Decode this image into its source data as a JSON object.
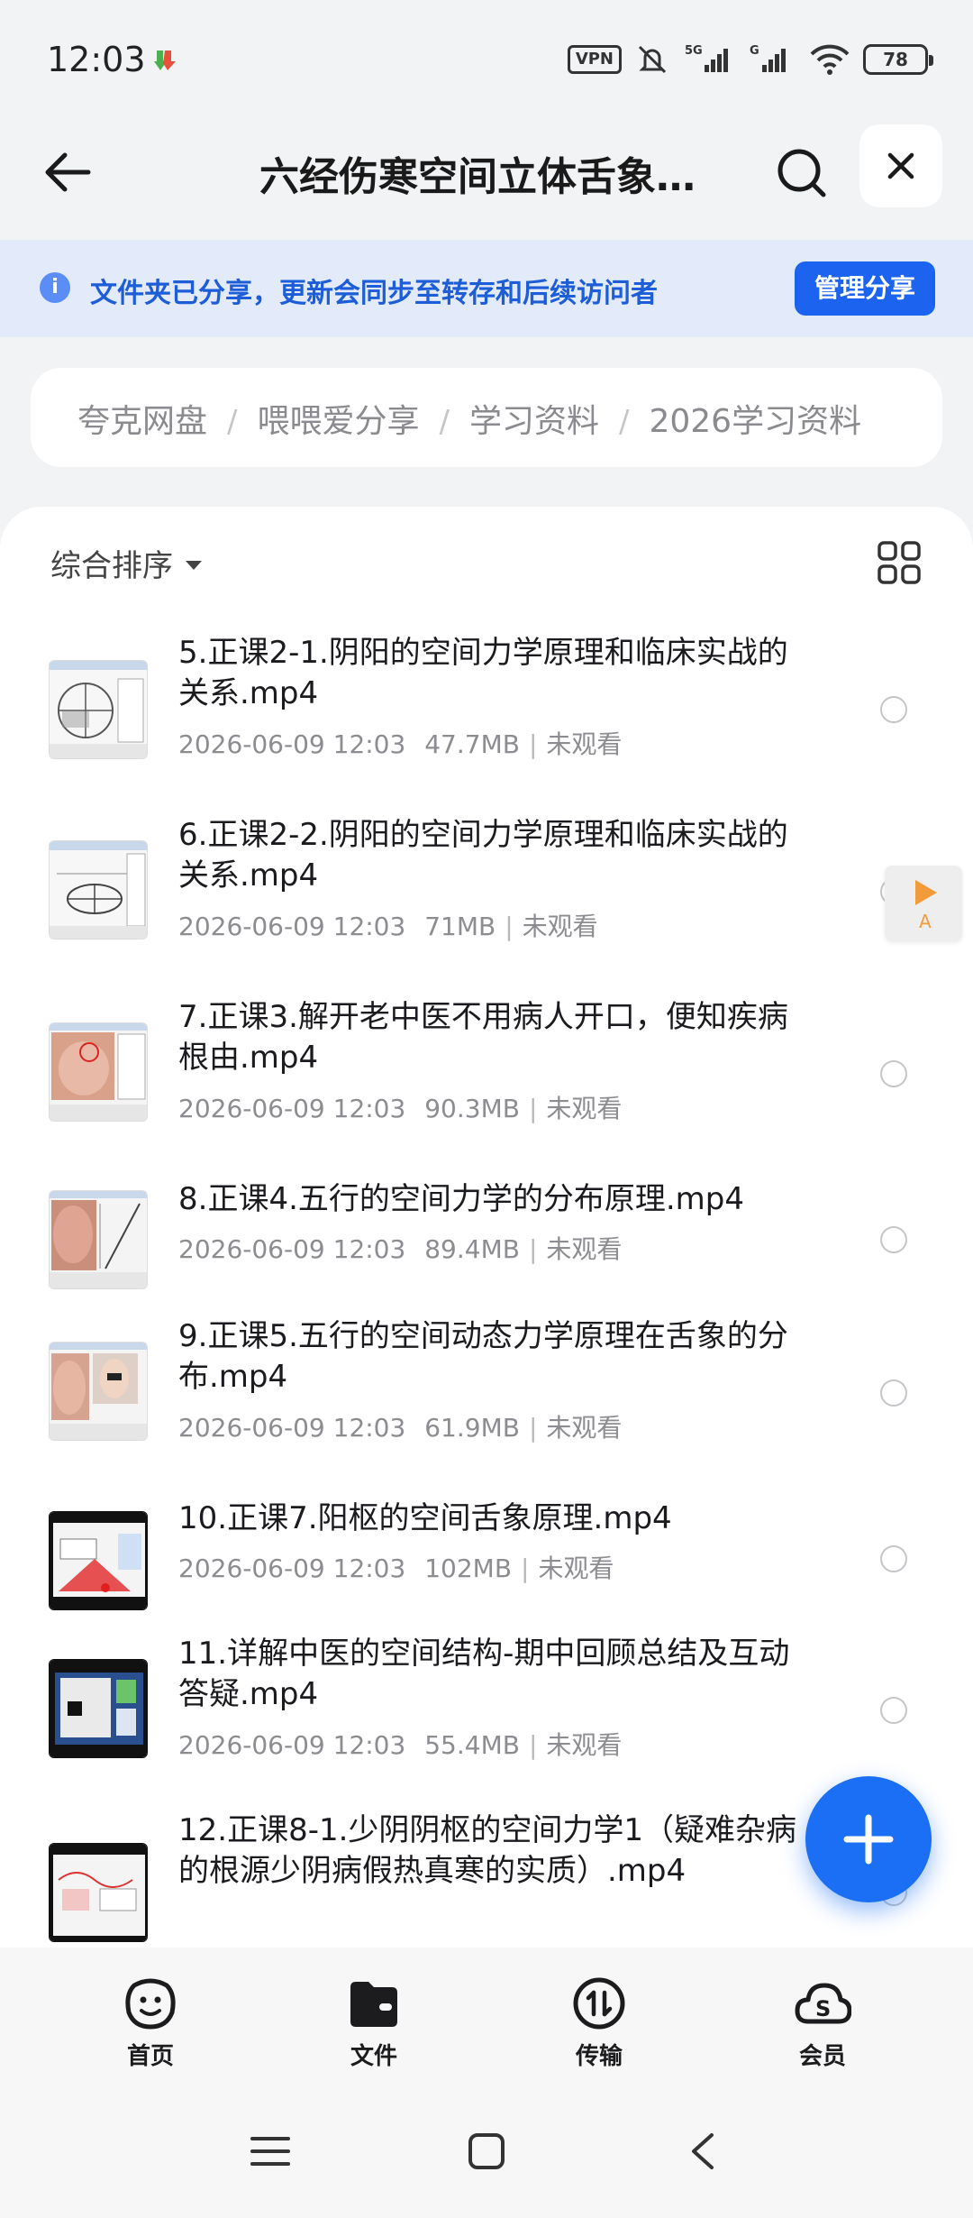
{
  "status_bar": {
    "time": "12:03",
    "vpn": "VPN",
    "battery": "78"
  },
  "header": {
    "title": "六经伤寒空间立体舌象…"
  },
  "share_banner": {
    "text": "文件夹已分享，更新会同步至转存和后续访问者",
    "button": "管理分享"
  },
  "breadcrumb": [
    "夸克网盘",
    "喂喂爱分享",
    "学习资料",
    "2026学习资料"
  ],
  "sort_label": "综合排序",
  "files": [
    {
      "name": "5.正课2-1.阴阳的空间力学原理和临床实战的关系.mp4",
      "date": "2026-06-09 12:03",
      "size": "47.7MB",
      "status": "未观看"
    },
    {
      "name": "6.正课2-2.阴阳的空间力学原理和临床实战的关系.mp4",
      "date": "2026-06-09 12:03",
      "size": "71MB",
      "status": "未观看"
    },
    {
      "name": "7.正课3.解开老中医不用病人开口，便知疾病根由.mp4",
      "date": "2026-06-09 12:03",
      "size": "90.3MB",
      "status": "未观看"
    },
    {
      "name": "8.正课4.五行的空间力学的分布原理.mp4",
      "date": "2026-06-09 12:03",
      "size": "89.4MB",
      "status": "未观看"
    },
    {
      "name": "9.正课5.五行的空间动态力学原理在舌象的分布.mp4",
      "date": "2026-06-09 12:03",
      "size": "61.9MB",
      "status": "未观看"
    },
    {
      "name": "10.正课7.阳枢的空间舌象原理.mp4",
      "date": "2026-06-09 12:03",
      "size": "102MB",
      "status": "未观看"
    },
    {
      "name": "11.详解中医的空间结构-期中回顾总结及互动答疑.mp4",
      "date": "2026-06-09 12:03",
      "size": "55.4MB",
      "status": "未观看"
    },
    {
      "name": "12.正课8-1.少阴阴枢的空间力学1（疑难杂病的根源少阴病假热真寒的实质）.mp4",
      "date": "",
      "size": "",
      "status": ""
    }
  ],
  "float_player_label": "A",
  "bottom_nav": [
    {
      "label": "首页",
      "icon": "smile-face-icon"
    },
    {
      "label": "文件",
      "icon": "folder-icon"
    },
    {
      "label": "传输",
      "icon": "transfer-icon"
    },
    {
      "label": "会员",
      "icon": "membership-cloud-icon"
    }
  ],
  "colors": {
    "accent": "#1c64ef",
    "banner_bg": "#e3ebfb",
    "banner_text": "#1d5ed8",
    "fab": "#1b6ff5",
    "play_orange": "#f39a3b"
  }
}
